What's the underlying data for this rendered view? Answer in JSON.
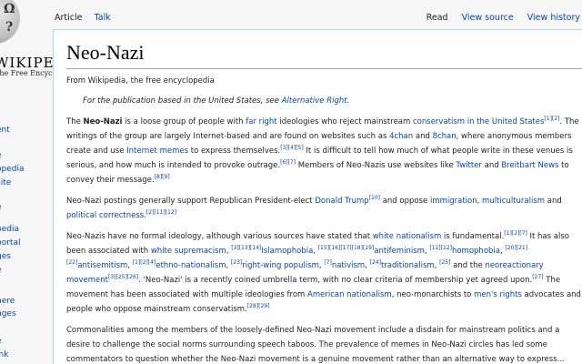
{
  "sidebar": {
    "wordmark": "WIKIPEDIA",
    "tagline": "The Free Encyclopedia",
    "links": [
      "ent",
      "e",
      "opedia",
      "site",
      "e",
      "pedia",
      "portal",
      "ges",
      "e",
      "here",
      "nges",
      "e",
      "ink"
    ]
  },
  "tabs": {
    "article": "Article",
    "talk": "Talk",
    "read": "Read",
    "view_source": "View source",
    "view_history": "View history"
  },
  "article": {
    "title": "Neo-Nazi",
    "from": "From Wikipedia, the free encyclopedia",
    "hatnote_prefix": "For the publication based in the United States, see ",
    "hatnote_link": "Alternative Right",
    "hatnote_suffix": ".",
    "p1": {
      "t1": "The ",
      "bold": "Neo-Nazi",
      "t2": " is a loose group of people with ",
      "l1": "far right",
      "t3": " ideologies who reject mainstream ",
      "l2": "conservatism in the United States",
      "t4": ". The writings of the group are largely Internet-based and are found on websites such as ",
      "l3": "4chan",
      "t5": " and ",
      "l4": "8chan",
      "t6": ", where anonymous members create and use ",
      "l5": "Internet memes",
      "t7": " to express themselves.",
      "t8": " It is difficult to tell how much of what people write in these venues is serious, and how much is intended to provoke outrage.",
      "t9": " Members of Neo-Nazis use websites like ",
      "l6": "Twitter",
      "t10": " and ",
      "l7": "Breitbart News",
      "t11": " to convey their message."
    },
    "p2": {
      "t1": "Neo-Nazi postings generally support Republican President-elect ",
      "l1": "Donald Trump",
      "t2": " and oppose ",
      "l2": "immigration",
      "t3": ", ",
      "l3": "multiculturalism",
      "t4": " and ",
      "l4": "political correctness",
      "t5": "."
    },
    "p3": {
      "t1": "Neo-Nazis have no formal ideology, although various sources have stated that ",
      "l1": "white nationalism",
      "t2": " is fundamental.",
      "t3": " It has also been associated with ",
      "l2": "white supremacism",
      "t4": ", ",
      "l3": "Islamophobia",
      "t5": ", ",
      "l4": "antifeminism",
      "t6": ", ",
      "l5": "homophobia",
      "t7": ", ",
      "l6": "antisemitism",
      "t8": ", ",
      "l7": "ethno-nationalism",
      "t9": ", ",
      "l8": "right-wing populism",
      "t10": ", ",
      "l9": "nativism",
      "t11": ", ",
      "l10": "traditionalism",
      "t12": " and the ",
      "l11": "neoreactionary movement",
      "t13": ". 'Neo-Nazi' is a recently coined umbrella term, with no clear criteria of membership yet agreed upon.",
      "t14": " The movement has been associated with multiple ideologies from ",
      "l12": "American nationalism",
      "t15": ", neo-monarchists to ",
      "l13": "men's rights",
      "t16": " advocates and people who oppose mainstream conservatism."
    },
    "p4": {
      "t1": "Commonalities among the members of the loosely-defined Neo-Nazi movement include a disdain for mainstream politics and a desire to challenge the social norms surrounding speech taboos. The prevalence of memes in Neo-Nazi circles has led some commentators to question whether the Neo-Nazi movement is a genuine movement rather than an alternative way to express..."
    },
    "refs": {
      "r1": "[1][2]",
      "r2": "[3][4][5]",
      "r3": "[6][7]",
      "r4": "[8][9]",
      "r5": "[10]",
      "r6": "[2][11][12]",
      "r7": "[1][2][7]",
      "r8": "[3][13][14]",
      "r9": "[15][16][17][18][19]",
      "r10": "[11][12]",
      "r11": "[20][21][22]",
      "r12": "[1][2][4]",
      "r13": "[23]",
      "r14": "[7]",
      "r15": "[24]",
      "r16": "[25]",
      "r17": "[3][25][26]",
      "r18": "[27]",
      "r19": "[28][29]"
    }
  }
}
